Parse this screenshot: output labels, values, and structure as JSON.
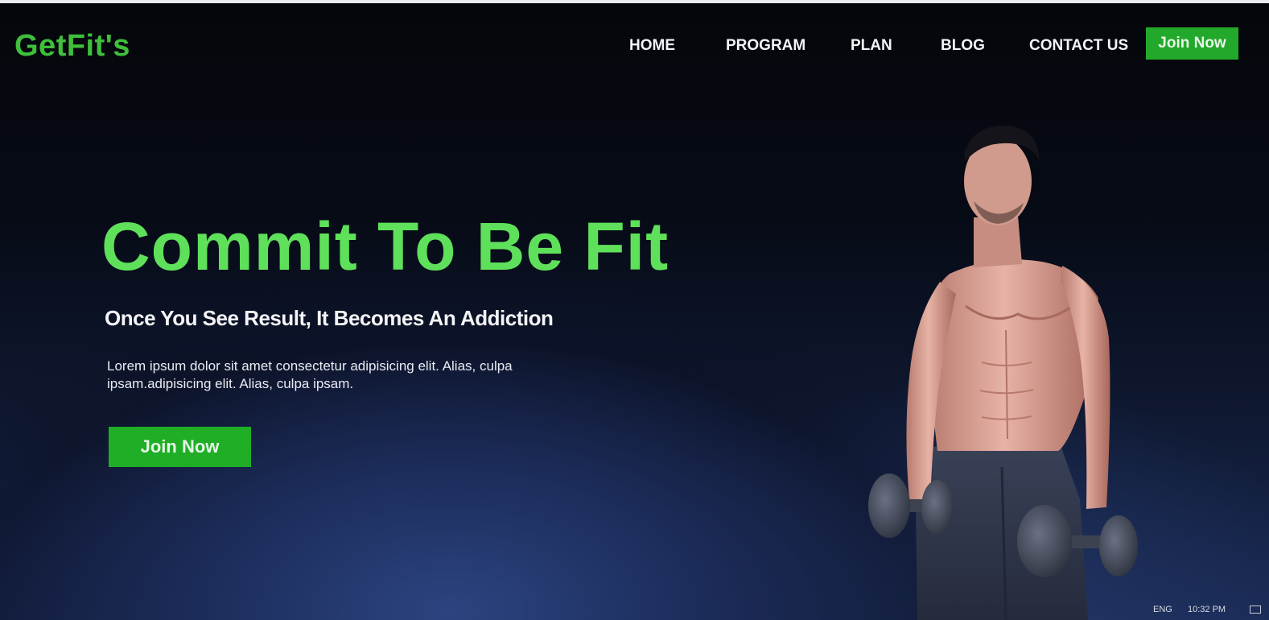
{
  "brand": {
    "logo": "GetFit's",
    "accent": "#3fbf3c",
    "button_color": "#22a82a"
  },
  "nav": {
    "items": [
      "HOME",
      "PROGRAM",
      "PLAN",
      "BLOG",
      "CONTACT US"
    ],
    "cta": "Join Now"
  },
  "hero": {
    "title": "Commit To Be Fit",
    "subtitle": "Once You See Result, It Becomes An Addiction",
    "text": "Lorem ipsum dolor sit amet consectetur adipisicing elit. Alias, culpa ipsam.adipisicing elit. Alias, culpa ipsam.",
    "cta": "Join Now"
  },
  "taskbar": {
    "language": "ENG",
    "time": "10:32 PM"
  }
}
